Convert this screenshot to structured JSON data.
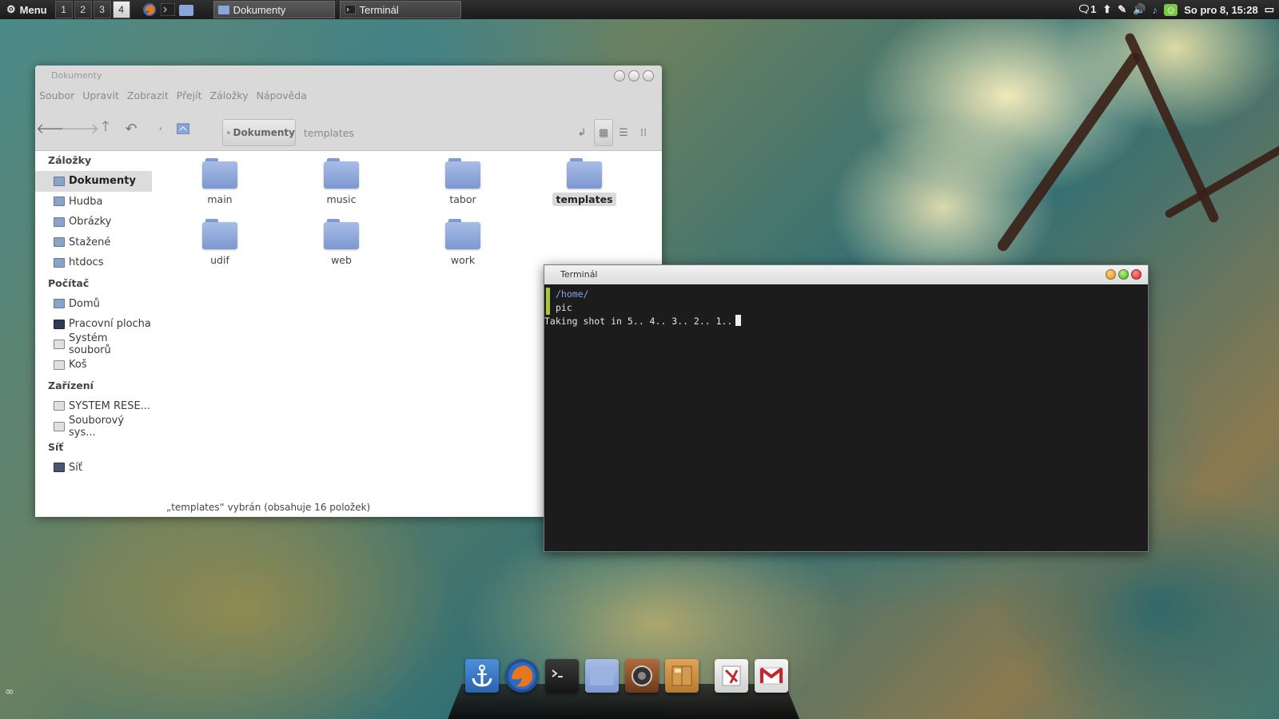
{
  "panel": {
    "menu_label": "Menu",
    "workspaces": [
      "1",
      "2",
      "3",
      "4"
    ],
    "active_workspace": "4",
    "tasks": [
      {
        "label": "Dokumenty",
        "icon": "folder-icon"
      },
      {
        "label": "Terminál",
        "icon": "terminal-icon"
      }
    ],
    "tray": {
      "messages_count": "1",
      "clock": "So pro  8, 15:28"
    }
  },
  "file_manager": {
    "title": "Dokumenty",
    "menu": [
      "Soubor",
      "Upravit",
      "Zobrazit",
      "Přejít",
      "Záložky",
      "Nápověda"
    ],
    "breadcrumb": {
      "current": "Dokumenty",
      "next": "templates"
    },
    "sidebar": {
      "sections": [
        {
          "header": "Záložky",
          "items": [
            "Dokumenty",
            "Hudba",
            "Obrázky",
            "Stažené",
            "htdocs"
          ]
        },
        {
          "header": "Počítač",
          "items": [
            "Domů",
            "Pracovní plocha",
            "Systém souborů",
            "Koš"
          ]
        },
        {
          "header": "Zařízení",
          "items": [
            "SYSTEM RESE...",
            "Souborový sys..."
          ]
        },
        {
          "header": "Síť",
          "items": [
            "Síť"
          ]
        }
      ],
      "selected": "Dokumenty"
    },
    "folders": [
      "main",
      "music",
      "tabor",
      "templates",
      "udif",
      "web",
      "work"
    ],
    "selected_folder": "templates",
    "status": "„templates“ vybrán (obsahuje 16 položek)"
  },
  "terminal": {
    "title": "Terminál",
    "lines": {
      "path": "/home/",
      "command": "pic",
      "output": "Taking shot in 5.. 4.. 3.. 2.. 1.."
    }
  },
  "dock": {
    "items": [
      "anchor-icon",
      "firefox-icon",
      "terminal-icon",
      "folder-icon",
      "speaker-icon",
      "archive-icon",
      "pdf-reader-icon",
      "gmail-icon"
    ]
  },
  "colors": {
    "panel_bg": "#222222",
    "terminal_bg": "#1c1c1c",
    "prompt_accent": "#a8c83a",
    "folder_blue": "#8aa5da"
  }
}
